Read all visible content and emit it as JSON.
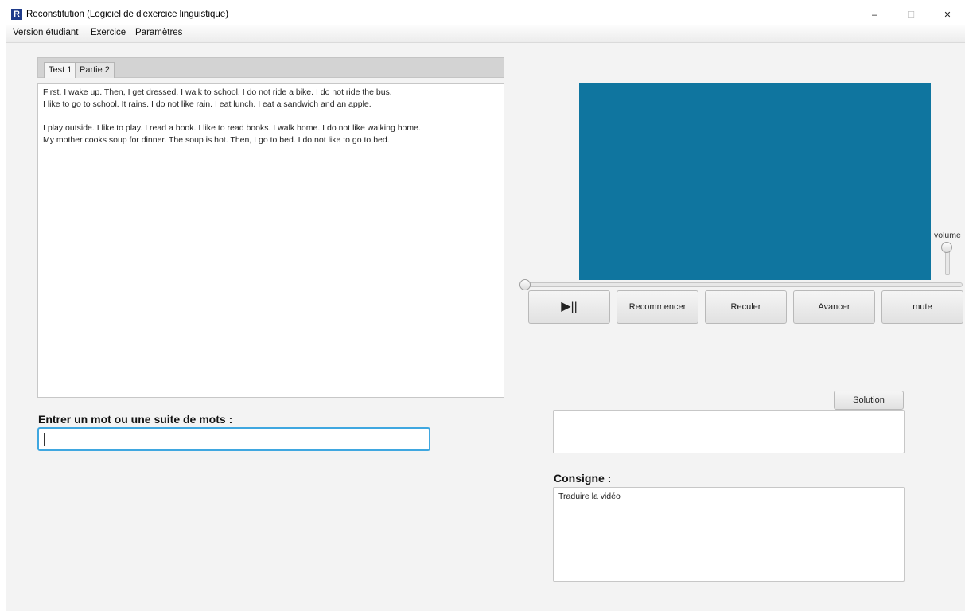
{
  "window": {
    "title": "Reconstitution (Logiciel de d'exercice linguistique)",
    "app_icon_letter": "R",
    "controls": {
      "minimize": "–",
      "maximize": "☐",
      "close": "✕"
    }
  },
  "menu": {
    "items": [
      "Version étudiant",
      "Exercice",
      "Paramètres"
    ]
  },
  "tabs": [
    {
      "label": "Test 1",
      "active": true
    },
    {
      "label": "Partie 2",
      "active": false
    }
  ],
  "text_lines": [
    "First, I wake up. Then, I get dressed. I walk to school. I do not ride a bike. I do not ride the bus.",
    "I like to go to school. It rains. I do not like rain. I eat lunch. I eat a sandwich and an apple.",
    "",
    "I play outside. I like to play. I read a book. I like to read books. I walk home. I do not like walking home.",
    "My mother cooks soup for dinner. The soup is hot. Then, I go to bed. I do not like to go to bed."
  ],
  "entry": {
    "label": "Entrer un mot ou une suite de mots :",
    "value": ""
  },
  "player": {
    "video_color": "#0f759f",
    "volume_label": "volume",
    "volume_level": 1.0,
    "seek_position": 0.0,
    "buttons": {
      "play_pause": "▶||",
      "restart": "Recommencer",
      "back": "Reculer",
      "forward": "Avancer",
      "mute": "mute"
    }
  },
  "solution": {
    "button_label": "Solution",
    "text": ""
  },
  "consigne": {
    "label": "Consigne :",
    "text": "Traduire la vidéo"
  },
  "colors": {
    "focus_border": "#3fa7e0",
    "app_icon_bg": "#1e3a8a"
  }
}
